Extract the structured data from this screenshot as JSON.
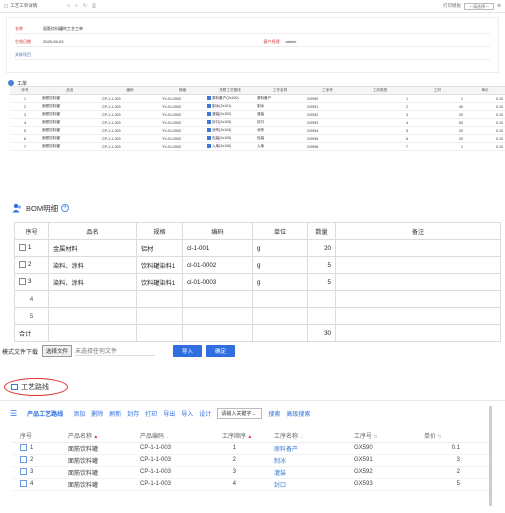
{
  "top": {
    "toolbar": {
      "title": "工艺工单详情",
      "right_label": "打印模板",
      "right_select": "一请选择一"
    },
    "form": [
      {
        "label": "名称",
        "value": "面筋饮料罐的工艺工单"
      },
      {
        "label": "生效日期",
        "value": "2025-06-03",
        "label2": "客户经理",
        "value2": "admin"
      },
      {
        "label": "关联项目",
        "value": ""
      }
    ],
    "section_title": "工单",
    "headers": [
      "序号",
      "品名",
      "编码",
      "规格",
      "关联工艺路线",
      "工作名称",
      "工序号",
      "工序类型",
      "工时",
      "单价"
    ],
    "rows": [
      [
        "1",
        "面筋饮料罐",
        "CP-1-1-003",
        "YX-01-2000",
        "原料备产(2x100)",
        "原料备产",
        "GX590",
        "1",
        "1",
        "0.10"
      ],
      [
        "2",
        "面筋饮料罐",
        "CP-1-1-003",
        "YX-01-2000",
        "制冰(2x101)",
        "制冰",
        "GX591",
        "2",
        "40",
        "0.10"
      ],
      [
        "3",
        "面筋饮料罐",
        "CP-1-1-003",
        "YX-01-2000",
        "灌装(2x102)",
        "灌装",
        "GX592",
        "3",
        "20",
        "0.10"
      ],
      [
        "4",
        "面筋饮料罐",
        "CP-1-1-003",
        "YX-01-2000",
        "封口(2x103)",
        "封口",
        "GX593",
        "4",
        "50",
        "0.10"
      ],
      [
        "5",
        "面筋饮料罐",
        "CP-1-1-003",
        "YX-01-2000",
        "消杀(2x104)",
        "消杀",
        "GX594",
        "5",
        "20",
        "0.10"
      ],
      [
        "6",
        "面筋饮料罐",
        "CP-1-1-003",
        "YX-01-2000",
        "包装(2x105)",
        "包装",
        "GX595",
        "6",
        "20",
        "0.10"
      ],
      [
        "7",
        "面筋饮料罐",
        "CP-1-1-003",
        "YX-01-2000",
        "入库(2x106)",
        "入库",
        "GX596",
        "7",
        "1",
        "0.10"
      ]
    ]
  },
  "bom": {
    "title": "BOM明细",
    "headers": [
      "序号",
      "品名",
      "规格",
      "编码",
      "单位",
      "数量",
      "备注"
    ],
    "rows": [
      {
        "no": "1",
        "name": "金属材料",
        "spec": "铝材",
        "code": "cl-1-001",
        "unit": "g",
        "qty": "20",
        "note": ""
      },
      {
        "no": "2",
        "name": "染料、涂料",
        "spec": "饮料罐染料1",
        "code": "cl-01-0002",
        "unit": "g",
        "qty": "5",
        "note": ""
      },
      {
        "no": "3",
        "name": "染料、涂料",
        "spec": "饮料罐染料1",
        "code": "cl-01-0003",
        "unit": "g",
        "qty": "5",
        "note": ""
      },
      {
        "no": "4",
        "name": "",
        "spec": "",
        "code": "",
        "unit": "",
        "qty": "",
        "note": ""
      },
      {
        "no": "5",
        "name": "",
        "spec": "",
        "code": "",
        "unit": "",
        "qty": "",
        "note": ""
      }
    ],
    "total_label": "合计",
    "total_qty": "30",
    "upload": {
      "label": "模式文件下载",
      "choose": "选择文件",
      "no_file": "未选择任何文件",
      "import": "导入",
      "confirm": "确定"
    }
  },
  "route": {
    "section_title": "工艺路线",
    "toolbar_title": "产品工艺路线",
    "actions": [
      "添加",
      "删除",
      "刷新",
      "封存",
      "打印",
      "导出",
      "导入",
      "设计"
    ],
    "keyword_placeholder": "请输入关键字...",
    "search": "搜索",
    "advanced_search": "高级搜索",
    "headers": [
      "序号",
      "产品名称",
      "产品编码",
      "工序顺序",
      "工序名称",
      "工序号",
      "单价"
    ],
    "rows": [
      {
        "no": "1",
        "name": "面筋饮料罐",
        "code": "CP-1-1-003",
        "order": "1",
        "proc": "原料备产",
        "proc_no": "GX590",
        "price": "0.1"
      },
      {
        "no": "2",
        "name": "面筋饮料罐",
        "code": "CP-1-1-003",
        "order": "2",
        "proc": "制冰",
        "proc_no": "GX591",
        "price": "3"
      },
      {
        "no": "3",
        "name": "面筋饮料罐",
        "code": "CP-1-1-003",
        "order": "3",
        "proc": "灌装",
        "proc_no": "GX592",
        "price": "2"
      },
      {
        "no": "4",
        "name": "面筋饮料罐",
        "code": "CP-1-1-003",
        "order": "4",
        "proc": "封口",
        "proc_no": "GX593",
        "price": "5"
      }
    ]
  },
  "colors": {
    "accent": "#2f6fe0",
    "highlight": "#e03131"
  }
}
